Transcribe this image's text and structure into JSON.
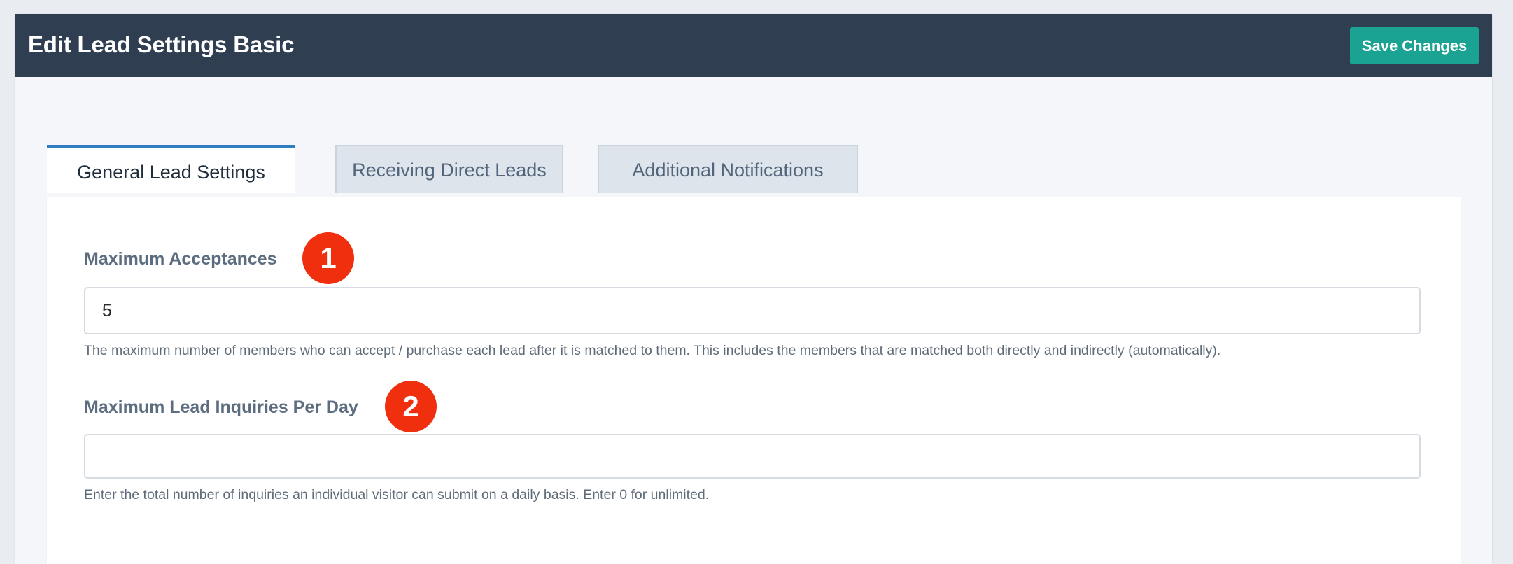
{
  "header": {
    "title": "Edit Lead Settings Basic",
    "save_label": "Save Changes"
  },
  "tabs": [
    {
      "label": "General Lead Settings",
      "active": true
    },
    {
      "label": "Receiving Direct Leads",
      "active": false
    },
    {
      "label": "Additional Notifications",
      "active": false
    }
  ],
  "fields": {
    "max_acceptances": {
      "label": "Maximum Acceptances",
      "badge": "1",
      "value": "5",
      "help": "The maximum number of members who can accept / purchase each lead after it is matched to them. This includes the members that are matched both directly and indirectly (automatically)."
    },
    "max_inquiries": {
      "label": "Maximum Lead Inquiries Per Day",
      "badge": "2",
      "value": "",
      "help": "Enter the total number of inquiries an individual visitor can submit on a daily basis. Enter 0 for unlimited."
    }
  },
  "colors": {
    "header_bg": "#2f3e50",
    "accent": "#1aa392",
    "tab_active_border": "#2d7fbf",
    "badge": "#f02f0f"
  }
}
